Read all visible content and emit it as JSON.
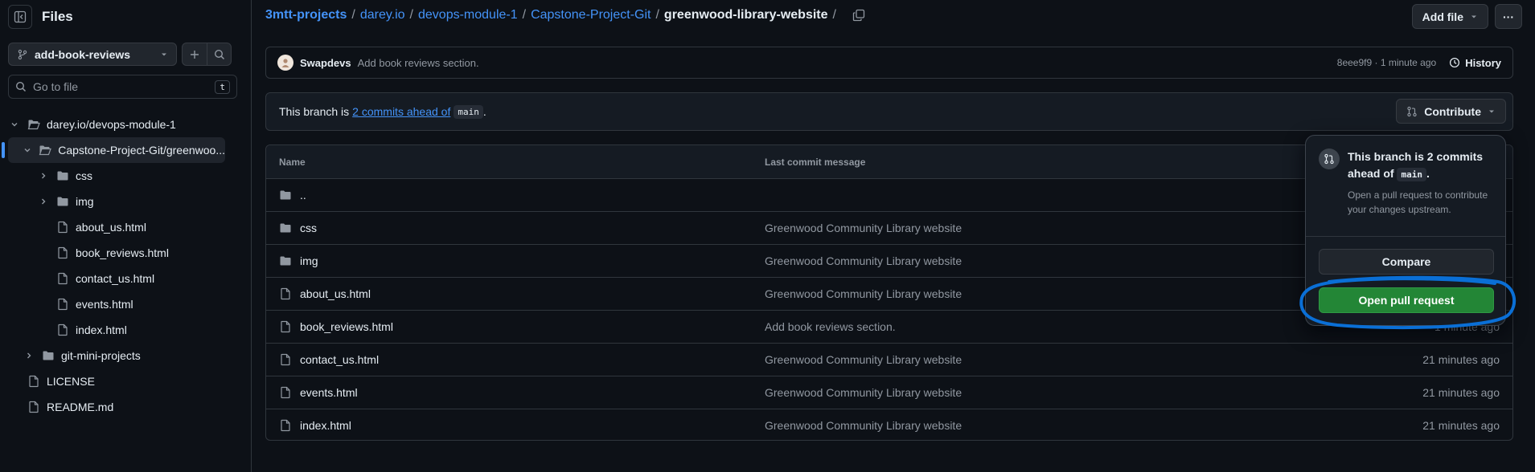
{
  "sidebar": {
    "title": "Files",
    "branch": "add-book-reviews",
    "goto_placeholder": "Go to file",
    "goto_shortcut": "t",
    "tree": [
      {
        "label": "darey.io/devops-module-1",
        "type": "folder-open",
        "depth": 0,
        "chevron": "down"
      },
      {
        "label": "Capstone-Project-Git/greenwoo...",
        "type": "folder-open",
        "depth": 1,
        "chevron": "down",
        "active": true
      },
      {
        "label": "css",
        "type": "folder",
        "depth": 2,
        "chevron": "right"
      },
      {
        "label": "img",
        "type": "folder",
        "depth": 2,
        "chevron": "right"
      },
      {
        "label": "about_us.html",
        "type": "file",
        "depth": 2
      },
      {
        "label": "book_reviews.html",
        "type": "file",
        "depth": 2
      },
      {
        "label": "contact_us.html",
        "type": "file",
        "depth": 2
      },
      {
        "label": "events.html",
        "type": "file",
        "depth": 2
      },
      {
        "label": "index.html",
        "type": "file",
        "depth": 2
      },
      {
        "label": "git-mini-projects",
        "type": "folder",
        "depth": 1,
        "chevron": "right"
      },
      {
        "label": "LICENSE",
        "type": "file",
        "depth": 0
      },
      {
        "label": "README.md",
        "type": "file",
        "depth": 0
      }
    ]
  },
  "breadcrumb": {
    "owner": "3mtt-projects",
    "parts": [
      "darey.io",
      "devops-module-1",
      "Capstone-Project-Git"
    ],
    "current": "greenwood-library-website",
    "sep": "/"
  },
  "actions": {
    "add_file": "Add file",
    "more": "···"
  },
  "commit": {
    "author": "Swapdevs",
    "message": "Add book reviews section.",
    "meta": "8eee9f9 · 1 minute ago",
    "history": "History"
  },
  "ahead": {
    "prefix": "This branch is",
    "link": "2 commits ahead of",
    "base": "main",
    "suffix": ".",
    "contribute": "Contribute"
  },
  "table": {
    "headers": {
      "name": "Name",
      "message": "Last commit message",
      "date": ""
    },
    "rows": [
      {
        "name": "..",
        "type": "folder",
        "message": "",
        "date": ""
      },
      {
        "name": "css",
        "type": "folder",
        "message": "Greenwood Community Library website",
        "date": ""
      },
      {
        "name": "img",
        "type": "folder",
        "message": "Greenwood Community Library website",
        "date": ""
      },
      {
        "name": "about_us.html",
        "type": "file",
        "message": "Greenwood Community Library website",
        "date": ""
      },
      {
        "name": "book_reviews.html",
        "type": "file",
        "message": "Add book reviews section.",
        "date": "1 minute ago"
      },
      {
        "name": "contact_us.html",
        "type": "file",
        "message": "Greenwood Community Library website",
        "date": "21 minutes ago"
      },
      {
        "name": "events.html",
        "type": "file",
        "message": "Greenwood Community Library website",
        "date": "21 minutes ago"
      },
      {
        "name": "index.html",
        "type": "file",
        "message": "Greenwood Community Library website",
        "date": "21 minutes ago"
      }
    ]
  },
  "popover": {
    "title_prefix": "This branch is 2 commits ahead of",
    "title_code": "main",
    "title_suffix": ".",
    "description": "Open a pull request to contribute your changes upstream.",
    "compare": "Compare",
    "open_pr": "Open pull request"
  },
  "colors": {
    "background": "#0d1117",
    "link": "#4493f8",
    "green_button": "#238636",
    "annotation": "#0a6fd6"
  }
}
